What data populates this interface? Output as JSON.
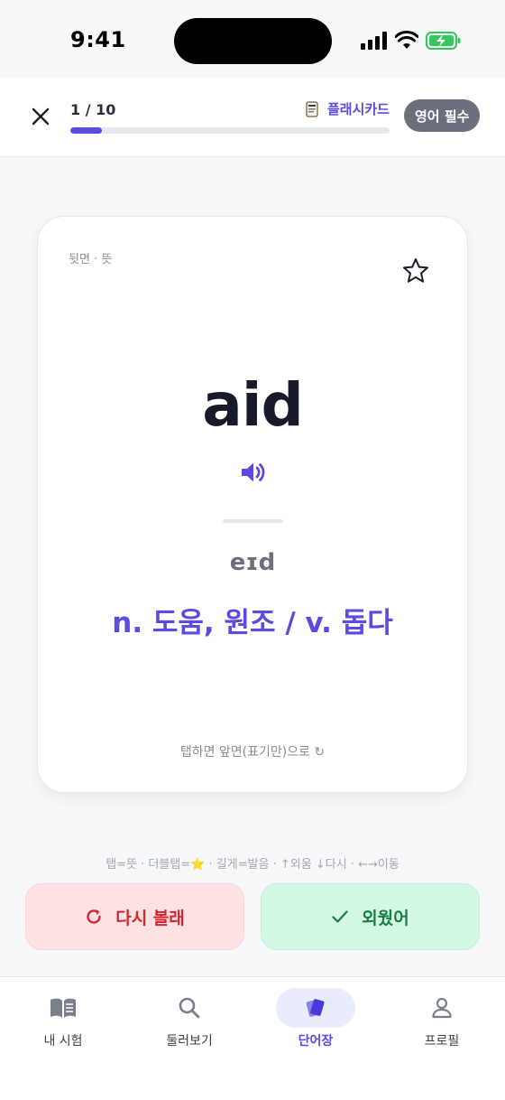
{
  "status": {
    "time": "9:41"
  },
  "header": {
    "progress_label": "1 / 10",
    "progress_fraction": 0.1,
    "mode_label": "플래시카드",
    "mode_icon": "flashcard-icon",
    "deck_chip": "영어 필수"
  },
  "card": {
    "side_label": "뒷면 · 뜻",
    "word": "aid",
    "pronunciation": "eɪd",
    "meaning": "n. 도움, 원조 / v. 돕다",
    "tap_hint": "탭하면 앞면(표기만)으로 ↻"
  },
  "shortcuts_hint": "탭=뜻 · 더블탭=⭐ · 길게=발음 · ↑외움 ↓다시 · ←→이동",
  "actions": {
    "again_label": "다시 볼래",
    "known_label": "외웠어"
  },
  "tabs": [
    {
      "label": "내 시험",
      "icon": "book-icon"
    },
    {
      "label": "둘러보기",
      "icon": "search-icon"
    },
    {
      "label": "단어장",
      "icon": "cards-icon"
    },
    {
      "label": "프로필",
      "icon": "user-icon"
    }
  ],
  "colors": {
    "accent": "#5b4be0",
    "again_bg": "#ffe2e3",
    "again_text": "#d5262f",
    "known_bg": "#d3f8e3",
    "known_text": "#1b7a45",
    "battery": "#34c759"
  }
}
